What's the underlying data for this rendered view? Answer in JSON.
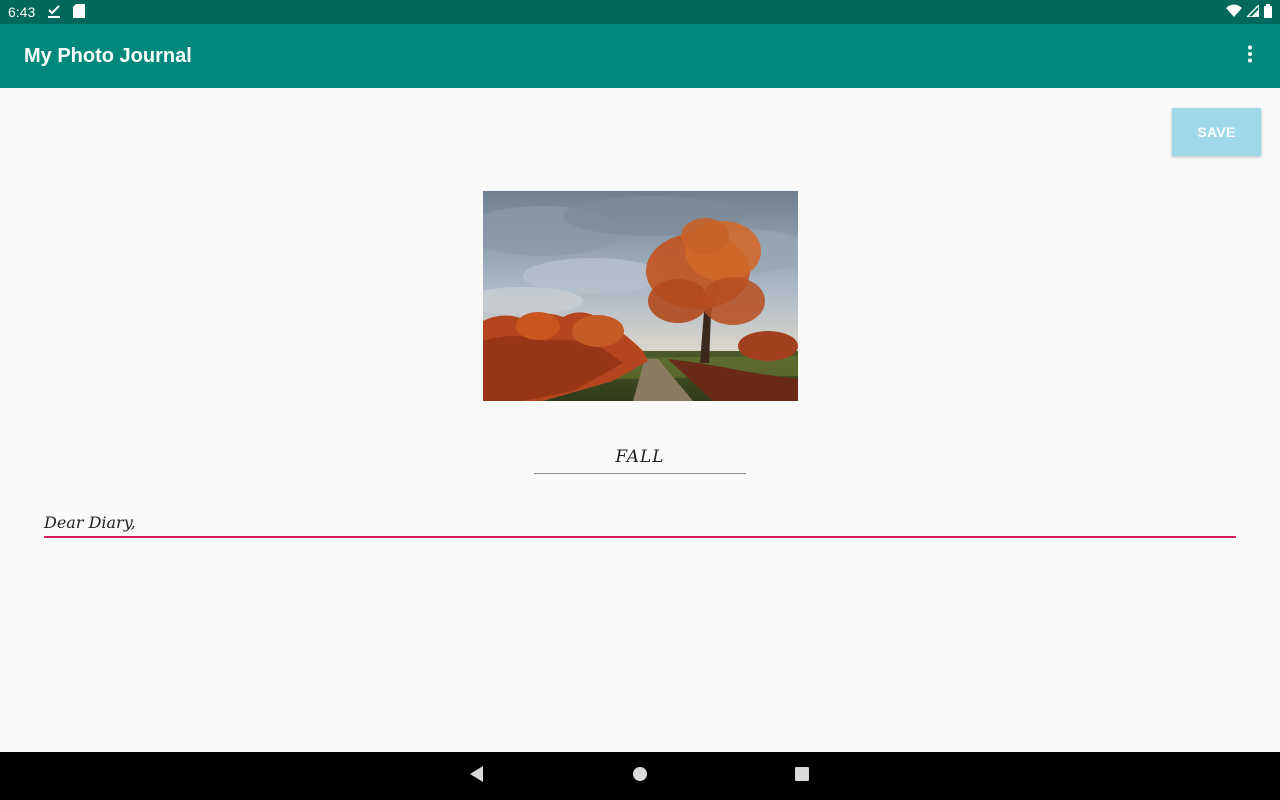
{
  "status_bar": {
    "time": "6:43",
    "left_icons": [
      "checkmark-download-icon",
      "sd-card-icon"
    ],
    "right_icons": [
      "wifi-icon",
      "cell-signal-icon",
      "battery-icon"
    ]
  },
  "app_bar": {
    "title": "My Photo Journal",
    "overflow_icon": "more-vert-icon"
  },
  "main": {
    "save_label": "SAVE",
    "photo_icon": "autumn-tree-photo",
    "title_value": "FALL",
    "entry_value": "Dear Diary,"
  },
  "nav_bar": {
    "icons": [
      "back-icon",
      "home-icon",
      "recents-icon"
    ]
  },
  "colors": {
    "status_bar": "#00695c",
    "app_bar": "#00897b",
    "save_button": "#9fd9e9",
    "entry_underline": "#d81b60",
    "background": "#fafafa"
  }
}
